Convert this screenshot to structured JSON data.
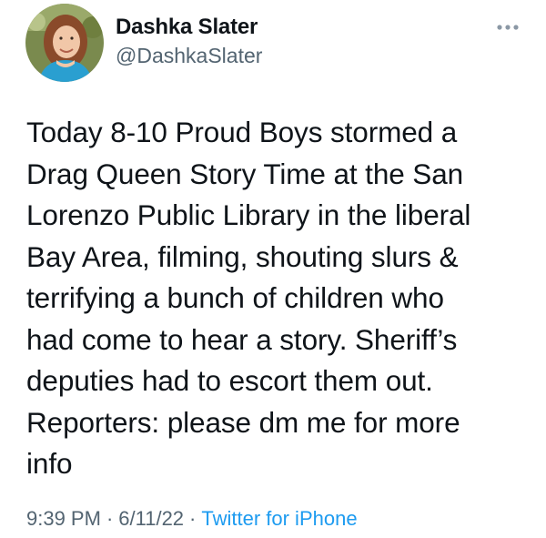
{
  "author": {
    "display_name": "Dashka Slater",
    "handle": "@DashkaSlater",
    "avatar_icon": "profile-photo"
  },
  "more_icon": "more-horizontal-icon",
  "tweet": {
    "text": "Today 8-10 Proud Boys stormed a\nDrag Queen Story Time at the San\nLorenzo Public Library in the liberal\nBay Area, filming, shouting slurs &\nterrifying a bunch of children who\nhad come to hear a story. Sheriff’s\ndeputies had to escort them out.\nReporters: please dm me for more\ninfo",
    "time": "9:39 PM",
    "separator": "·",
    "date": "6/11/22",
    "source": "Twitter for iPhone"
  },
  "colors": {
    "text": "#0f1419",
    "secondary": "#536471",
    "link": "#1d9bf0"
  }
}
